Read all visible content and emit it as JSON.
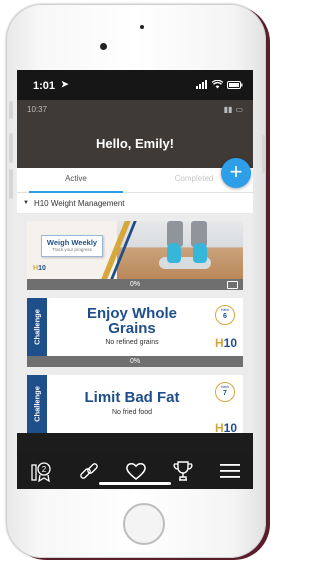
{
  "status_bar": {
    "time": "1:01"
  },
  "inner_status": {
    "time": "10:37"
  },
  "header": {
    "greeting": "Hello, Emily!"
  },
  "fab": {
    "label": "+"
  },
  "tabs": [
    {
      "label": "Active",
      "active": true
    },
    {
      "label": "Completed",
      "active": false
    }
  ],
  "section": {
    "title": "H10 Weight Management"
  },
  "cards": [
    {
      "title": "Weigh Weekly",
      "subtitle": "Track your progress",
      "brand": "H10",
      "progress": "0%"
    },
    {
      "tag": "Challenge",
      "title_line1": "Enjoy Whole",
      "title_line2": "Grains",
      "subtitle": "No refined grains",
      "habit_label": "Habit",
      "habit_number": "6",
      "brand": "H10",
      "progress": "0%"
    },
    {
      "tag": "Challenge",
      "title_line1": "Limit Bad Fat",
      "subtitle": "No fried food",
      "habit_label": "Habit",
      "habit_number": "7",
      "brand": "H10"
    }
  ],
  "tab_bar": {
    "items": [
      {
        "icon": "badge-2-icon",
        "label": "2"
      },
      {
        "icon": "link-icon"
      },
      {
        "icon": "heart-icon"
      },
      {
        "icon": "trophy-icon"
      },
      {
        "icon": "menu-icon"
      }
    ]
  },
  "colors": {
    "brand_blue": "#1f4f8a",
    "brand_gold": "#d6a73a",
    "accent": "#2d9ee8",
    "header": "#3f3a36"
  }
}
